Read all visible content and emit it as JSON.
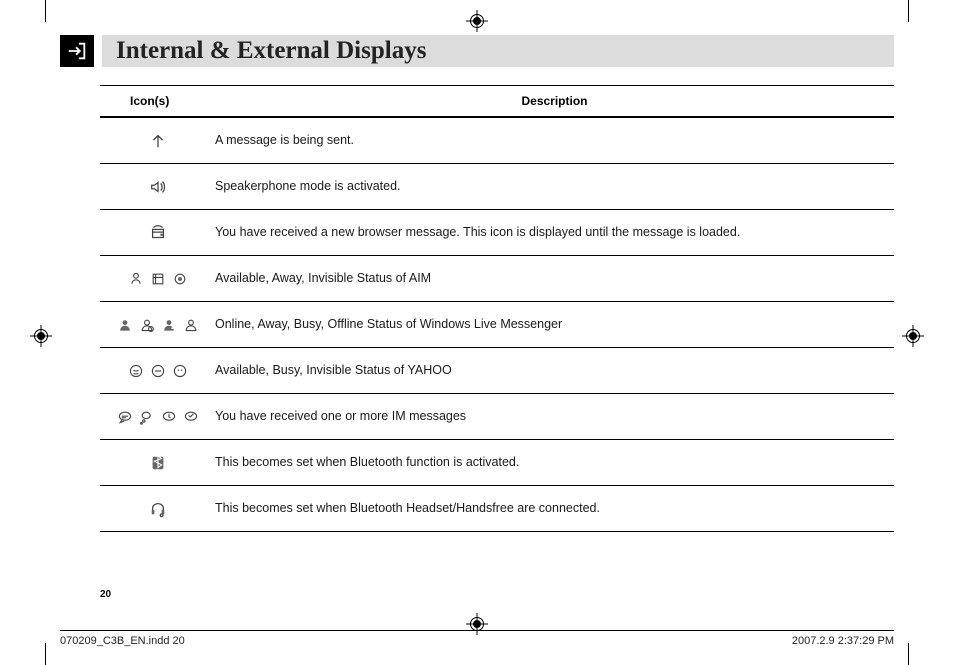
{
  "title": "Internal & External Displays",
  "page_number": "20",
  "table": {
    "header_icons": "Icon(s)",
    "header_desc": "Description",
    "rows": [
      {
        "icon_names": [
          "arrow-up-icon"
        ],
        "desc": "A message is being sent."
      },
      {
        "icon_names": [
          "speakerphone-icon"
        ],
        "desc": "Speakerphone mode is activated."
      },
      {
        "icon_names": [
          "browser-message-icon"
        ],
        "desc": "You have received a new browser message. This icon is displayed until the message is loaded."
      },
      {
        "icon_names": [
          "aim-available-icon",
          "aim-away-icon",
          "aim-invisible-icon"
        ],
        "desc": "Available, Away, Invisible Status of AIM"
      },
      {
        "icon_names": [
          "wlm-online-icon",
          "wlm-away-icon",
          "wlm-busy-icon",
          "wlm-offline-icon"
        ],
        "desc": "Online, Away, Busy, Offline Status of Windows Live Messenger"
      },
      {
        "icon_names": [
          "yahoo-available-icon",
          "yahoo-busy-icon",
          "yahoo-invisible-icon"
        ],
        "desc": "Available, Busy, Invisible Status of YAHOO"
      },
      {
        "icon_names": [
          "im-bubble-1-icon",
          "im-bubble-2-icon",
          "im-bubble-3-icon",
          "im-bubble-4-icon"
        ],
        "desc": "You have received one or more IM messages"
      },
      {
        "icon_names": [
          "bluetooth-icon"
        ],
        "desc": "This becomes set when Bluetooth function is activated."
      },
      {
        "icon_names": [
          "bluetooth-headset-icon"
        ],
        "desc": "This becomes set when Bluetooth Headset/Handsfree are connected."
      }
    ]
  },
  "slug": {
    "file": "070209_C3B_EN.indd   20",
    "date": "2007.2.9   2:37:29 PM"
  }
}
